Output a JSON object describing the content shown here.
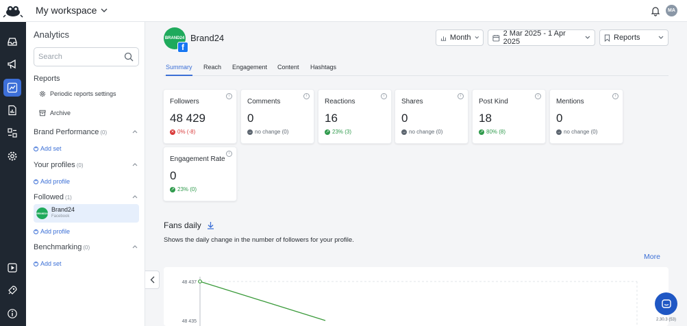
{
  "topbar": {
    "workspace": "My workspace",
    "avatar_initials": "MA"
  },
  "sidebar": {
    "title": "Analytics",
    "search_placeholder": "Search",
    "reports_label": "Reports",
    "reports_items": [
      "Periodic reports settings",
      "Archive"
    ],
    "brand_performance": {
      "label": "Brand Performance",
      "count": "(0)",
      "add": "Add set"
    },
    "your_profiles": {
      "label": "Your profiles",
      "count": "(0)",
      "add": "Add profile"
    },
    "followed": {
      "label": "Followed",
      "count": "(1)",
      "add": "Add profile",
      "item_name": "Brand24",
      "item_sub": "Facebook",
      "item_logo_text": "BRAND24"
    },
    "benchmarking": {
      "label": "Benchmarking",
      "count": "(0)",
      "add": "Add set"
    }
  },
  "header": {
    "brand_name": "Brand24",
    "brand_logo_text": "BRAND24",
    "period_label": "Month",
    "date_range": "2 Mar 2025 - 1 Apr 2025",
    "reports_label": "Reports"
  },
  "tabs": [
    "Summary",
    "Reach",
    "Engagement",
    "Content",
    "Hashtags"
  ],
  "active_tab": "Summary",
  "metrics": [
    {
      "title": "Followers",
      "value": "48 429",
      "change": "0% (-8)",
      "trend": "down"
    },
    {
      "title": "Comments",
      "value": "0",
      "change": "no change (0)",
      "trend": "flat"
    },
    {
      "title": "Reactions",
      "value": "16",
      "change": "23% (3)",
      "trend": "up"
    },
    {
      "title": "Shares",
      "value": "0",
      "change": "no change (0)",
      "trend": "flat"
    },
    {
      "title": "Post Kind",
      "value": "18",
      "change": "80% (8)",
      "trend": "up"
    },
    {
      "title": "Mentions",
      "value": "0",
      "change": "no change (0)",
      "trend": "flat"
    },
    {
      "title": "Engagement Rate",
      "value": "0",
      "change": "23% (0)",
      "trend": "up"
    }
  ],
  "fans": {
    "title": "Fans daily",
    "description": "Shows the daily change in the number of followers for your profile.",
    "more": "More"
  },
  "chart_data": {
    "type": "line",
    "y_ticks": [
      "48 437",
      "48 435"
    ],
    "series": [
      {
        "values": [
          48437,
          48435
        ]
      }
    ],
    "color": "#3a9a3a"
  },
  "footer": {
    "version": "2.30.3 (53)"
  },
  "colors": {
    "accent": "#3b6fd6",
    "rail": "#1f2731",
    "positive": "#2f9a4c",
    "negative": "#d93a3a"
  }
}
